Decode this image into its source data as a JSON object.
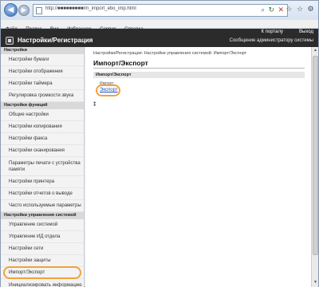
{
  "browser": {
    "back_glyph": "◀",
    "forward_glyph": "▶",
    "url": "http://■■■■■■■■■/m_import_ebo_imp.html",
    "search_icon": "⌕",
    "refresh_icon": "↻",
    "stop_icon": "✕",
    "window_controls": [
      "☆",
      "☆",
      "⚙"
    ]
  },
  "menu": [
    "Файл",
    "Правка",
    "Вид",
    "Избранное",
    "Сервис",
    "Справка"
  ],
  "header": {
    "portal_link": "К порталу",
    "logout_link": "Выход",
    "title": "Настройки/Регистрация",
    "message": "Сообщение администратору системы"
  },
  "sidebar": {
    "sections": [
      {
        "title": "Настройки",
        "items": [
          "Настройки бумаги",
          "Настройки отображения",
          "Настройки таймера",
          "Регулировка громкости звука"
        ]
      },
      {
        "title": "Настройки функций",
        "items": [
          "Общие настройки",
          "Настройки копирования",
          "Настройки факса",
          "Настройки сканирования",
          "Параметры печати с устройства памяти",
          "Настройки принтера",
          "Настройки отчетов о выводе",
          "Часто используемые параметры"
        ]
      },
      {
        "title": "Настройки управления системой",
        "items": [
          "Управление системой",
          "Управление ИД отдела",
          "Настройки сети",
          "Настройки защиты",
          "Импорт/Экспорт",
          "Инициализировать информацию системы"
        ]
      }
    ]
  },
  "content": {
    "breadcrumb": "Настройки/Регистрация: Настройки управления системой: Импорт/Экспорт",
    "page_title": "Импорт/Экспорт",
    "panel_title": "Импорт/Экспорт",
    "import_label": "Импорт",
    "export_link": "Экспорт",
    "footer_mark": "⁑"
  },
  "scrollbar": {
    "up": "▲",
    "down": "▼"
  },
  "colors": {
    "highlight": "#f2a23c",
    "header_bg": "#2b2b2b",
    "link": "#1d4fb8"
  }
}
